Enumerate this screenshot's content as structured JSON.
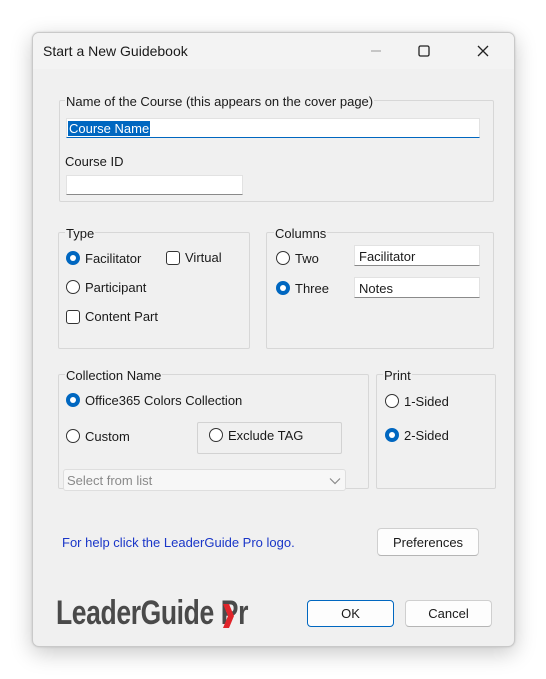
{
  "window": {
    "title": "Start a New Guidebook",
    "minimize_icon": "minimize-icon",
    "maximize_icon": "maximize-icon",
    "close_icon": "close-icon"
  },
  "course": {
    "name_label": "Name of the Course (this appears on the cover page)",
    "name_value": "Course Name",
    "id_label": "Course ID",
    "id_value": ""
  },
  "type": {
    "label": "Type",
    "facilitator": "Facilitator",
    "virtual": "Virtual",
    "participant": "Participant",
    "content_part": "Content Part",
    "selected": "Facilitator"
  },
  "columns": {
    "label": "Columns",
    "two": "Two",
    "three": "Three",
    "selected": "Three",
    "field1": "Facilitator",
    "field2": "Notes"
  },
  "collection": {
    "label": "Collection Name",
    "office365": "Office365 Colors Collection",
    "custom": "Custom",
    "exclude_tag": "Exclude TAG",
    "select_placeholder": "Select from list",
    "selected": "Office365 Colors Collection"
  },
  "print": {
    "label": "Print",
    "one_sided": "1-Sided",
    "two_sided": "2-Sided",
    "selected": "2-Sided"
  },
  "footer": {
    "help_link": "For help click the LeaderGuide Pro logo.",
    "preferences": "Preferences",
    "logo_text": "LeaderGuide Pr",
    "ok": "OK",
    "cancel": "Cancel"
  },
  "colors": {
    "accent": "#0067c0",
    "link": "#1a36c8",
    "logo_text": "#4a4a4a",
    "logo_red": "#e0252b"
  }
}
